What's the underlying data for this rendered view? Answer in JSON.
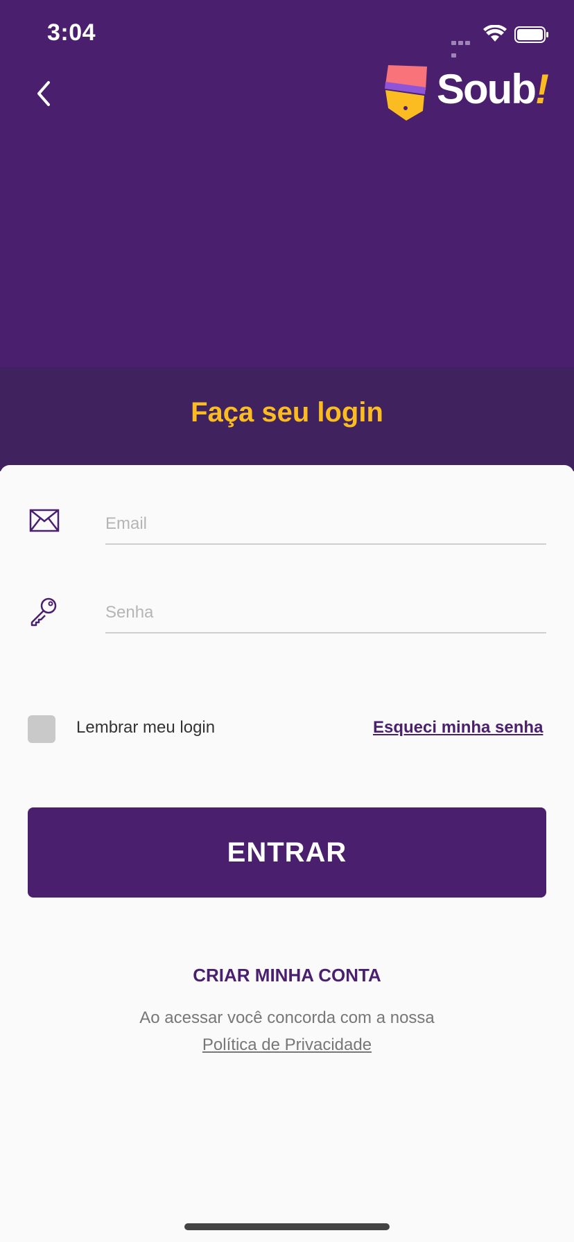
{
  "status_bar": {
    "time": "3:04",
    "icons": [
      "signal-icon",
      "wifi-icon",
      "battery-icon"
    ]
  },
  "header": {
    "back_icon": "chevron-left-icon",
    "logo_text": "Soub",
    "logo_bang": "!"
  },
  "page": {
    "title": "Faça seu login"
  },
  "form": {
    "email": {
      "icon": "mail-icon",
      "placeholder": "Email",
      "value": ""
    },
    "password": {
      "icon": "key-icon",
      "placeholder": "Senha",
      "value": ""
    },
    "remember_label": "Lembrar meu login",
    "remember_checked": false,
    "forgot_label": "Esqueci minha senha",
    "submit_label": "ENTRAR"
  },
  "footer": {
    "create_account_label": "CRIAR MINHA CONTA",
    "agreement_text": "Ao acessar você concorda com a nossa",
    "privacy_link": "Política de Privacidade"
  },
  "colors": {
    "primary": "#4a1f6e",
    "accent": "#fbbc22",
    "title_band": "#40225f"
  }
}
